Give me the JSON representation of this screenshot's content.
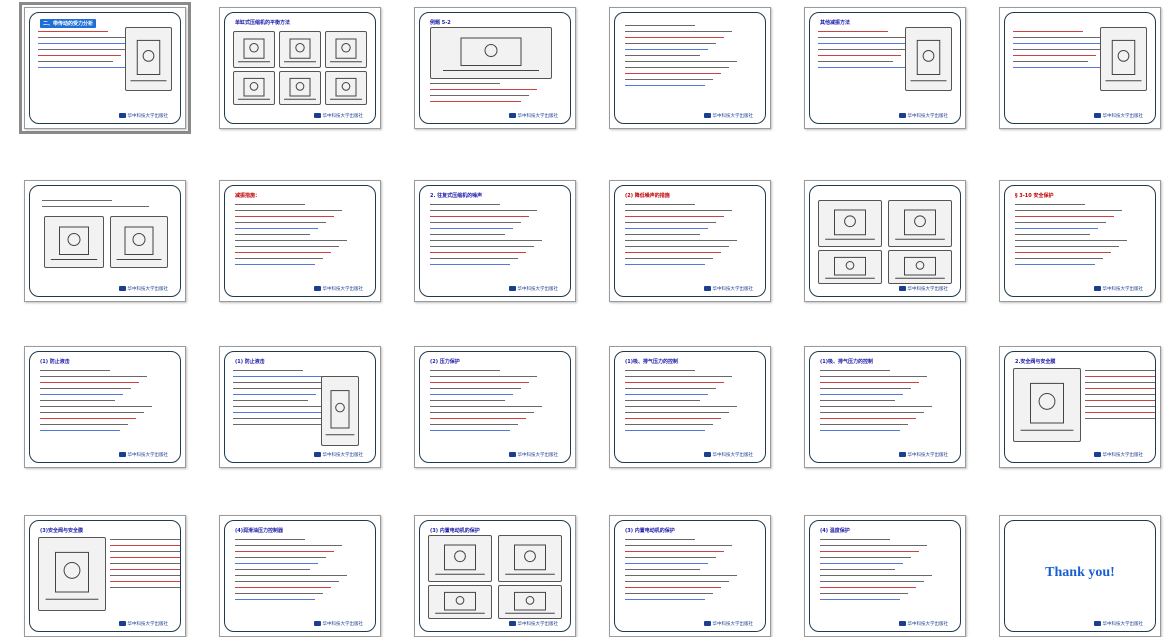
{
  "app": {
    "view": "slide-sorter"
  },
  "footer_text": "华中科技大学出版社",
  "slides": [
    {
      "title": "二、带传动的受力分析",
      "style": "box",
      "selected": true,
      "variant": "mix"
    },
    {
      "title": "单缸式压缩机的平衡方法",
      "style": "bl",
      "variant": "diagram"
    },
    {
      "title": "例题 5-2",
      "style": "bl",
      "variant": "crank"
    },
    {
      "title": "",
      "style": "",
      "variant": "text"
    },
    {
      "title": "其他减振方法",
      "style": "bl",
      "variant": "mix"
    },
    {
      "title": "",
      "style": "",
      "variant": "mix"
    },
    {
      "title": "",
      "style": "",
      "variant": "drawing"
    },
    {
      "title": "减振措施：",
      "style": "",
      "variant": "text"
    },
    {
      "title": "2. 往复式压缩机的噪声",
      "style": "bl",
      "variant": "text"
    },
    {
      "title": "(2) 降低噪声的措施",
      "style": "",
      "variant": "text"
    },
    {
      "title": "",
      "style": "",
      "variant": "photos"
    },
    {
      "title": "§ 3-10 安全保护",
      "style": "",
      "variant": "text"
    },
    {
      "title": "(1) 防止液击",
      "style": "bl",
      "variant": "text"
    },
    {
      "title": "(1) 防止液击",
      "style": "bl",
      "variant": "mixdraw"
    },
    {
      "title": "(2) 压力保护",
      "style": "bl",
      "variant": "text"
    },
    {
      "title": "(1)吸、排气压力的控制",
      "style": "bl",
      "variant": "text"
    },
    {
      "title": "(1)吸、排气压力的控制",
      "style": "bl",
      "variant": "text"
    },
    {
      "title": "2.安全阀与安全膜",
      "style": "bl",
      "variant": "valve"
    },
    {
      "title": "(3)安全阀与安全膜",
      "style": "bl",
      "variant": "valve2"
    },
    {
      "title": "(4)润滑油压力控制器",
      "style": "bl",
      "variant": "text"
    },
    {
      "title": "(3) 内置电动机的保护",
      "style": "bl",
      "variant": "photos2"
    },
    {
      "title": "(3) 内置电动机的保护",
      "style": "bl",
      "variant": "text"
    },
    {
      "title": "(4) 温度保护",
      "style": "bl",
      "variant": "text"
    },
    {
      "title": "Thank you!",
      "style": "",
      "variant": "thanks"
    }
  ]
}
